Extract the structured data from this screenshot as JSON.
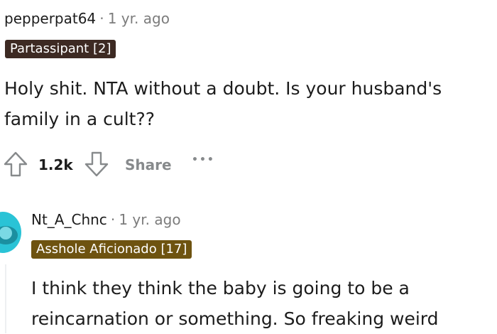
{
  "comment1": {
    "username": "pepperpat64",
    "separator": "·",
    "age": "1 yr. ago",
    "flair": "Partassipant [2]",
    "body_lines": [
      "Holy shit. NTA without a doubt. Is your husband's",
      "family in a cult??"
    ],
    "votes": "1.2k",
    "share_label": "Share",
    "more_label": "•••"
  },
  "comment2": {
    "username": "Nt_A_Chnc",
    "separator": "·",
    "age": "1 yr. ago",
    "flair": "Asshole Aficionado [17]",
    "body_lines": [
      "I think they think the baby is going to be a",
      "reincarnation or something. So freaking weird"
    ]
  },
  "colors": {
    "flair1_bg": "#3d2a23",
    "flair2_bg": "#6e5310",
    "avatar": "#2ac3d6",
    "icon_gray": "#878a8c"
  }
}
